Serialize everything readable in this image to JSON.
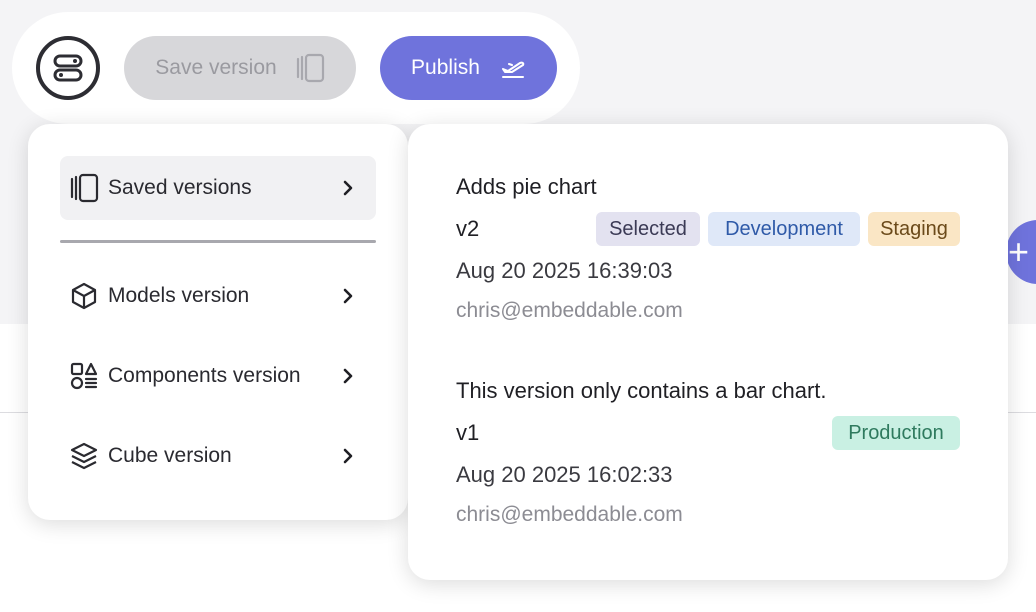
{
  "toolbar": {
    "save_label": "Save version",
    "publish_label": "Publish"
  },
  "menu": {
    "items": [
      {
        "label": "Saved versions",
        "icon": "saved-versions-icon"
      },
      {
        "label": "Models version",
        "icon": "cube-icon"
      },
      {
        "label": "Components version",
        "icon": "components-icon"
      },
      {
        "label": "Cube version",
        "icon": "layers-icon"
      }
    ]
  },
  "versions": [
    {
      "title": "Adds pie chart",
      "version": "v2",
      "date": "Aug 20 2025 16:39:03",
      "author": "chris@embeddable.com",
      "badges": [
        "Selected",
        "Development",
        "Staging"
      ]
    },
    {
      "title": "This version only contains a bar chart.",
      "version": "v1",
      "date": "Aug 20 2025 16:02:33",
      "author": "chris@embeddable.com",
      "badges": [
        "Production"
      ]
    }
  ],
  "colors": {
    "accent": "#6f73dc",
    "badge_selected_bg": "#e3e2f0",
    "badge_development_bg": "#dfe8f8",
    "badge_staging_bg": "#fae6c5",
    "badge_production_bg": "#c9f0e3"
  }
}
